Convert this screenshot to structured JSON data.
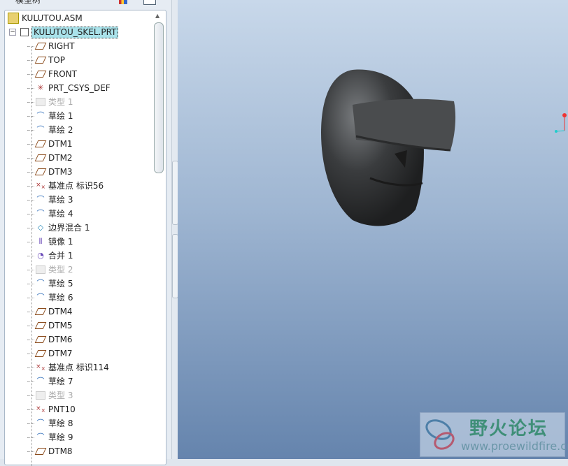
{
  "panel": {
    "title": "模型树"
  },
  "tree": {
    "root": "KULUTOU.ASM",
    "part": "KULUTOU_SKEL.PRT",
    "items": [
      {
        "label": "RIGHT",
        "icon": "datum-plane-icon"
      },
      {
        "label": "TOP",
        "icon": "datum-plane-icon"
      },
      {
        "label": "FRONT",
        "icon": "datum-plane-icon"
      },
      {
        "label": "PRT_CSYS_DEF",
        "icon": "csys-icon"
      },
      {
        "label": "类型 1",
        "icon": "suppressed-icon",
        "grey": true
      },
      {
        "label": "草绘 1",
        "icon": "sketch-icon"
      },
      {
        "label": "草绘 2",
        "icon": "sketch-icon"
      },
      {
        "label": "DTM1",
        "icon": "datum-plane-icon"
      },
      {
        "label": "DTM2",
        "icon": "datum-plane-icon"
      },
      {
        "label": "DTM3",
        "icon": "datum-plane-icon"
      },
      {
        "label": "基准点 标识56",
        "icon": "datum-point-icon"
      },
      {
        "label": "草绘 3",
        "icon": "sketch-icon"
      },
      {
        "label": "草绘 4",
        "icon": "sketch-icon"
      },
      {
        "label": "边界混合 1",
        "icon": "boundary-blend-icon"
      },
      {
        "label": "镜像 1",
        "icon": "mirror-icon"
      },
      {
        "label": "合并 1",
        "icon": "merge-icon"
      },
      {
        "label": "类型 2",
        "icon": "suppressed-icon",
        "grey": true
      },
      {
        "label": "草绘 5",
        "icon": "sketch-icon"
      },
      {
        "label": "草绘 6",
        "icon": "sketch-icon"
      },
      {
        "label": "DTM4",
        "icon": "datum-plane-icon"
      },
      {
        "label": "DTM5",
        "icon": "datum-plane-icon"
      },
      {
        "label": "DTM6",
        "icon": "datum-plane-icon"
      },
      {
        "label": "DTM7",
        "icon": "datum-plane-icon"
      },
      {
        "label": "基准点 标识114",
        "icon": "datum-point-icon"
      },
      {
        "label": "草绘 7",
        "icon": "sketch-icon"
      },
      {
        "label": "类型 3",
        "icon": "suppressed-icon",
        "grey": true
      },
      {
        "label": "PNT10",
        "icon": "datum-point-icon"
      },
      {
        "label": "草绘 8",
        "icon": "sketch-icon"
      },
      {
        "label": "草绘 9",
        "icon": "sketch-icon"
      },
      {
        "label": "DTM8",
        "icon": "datum-plane-icon"
      }
    ]
  },
  "watermark": {
    "name": "野火论坛",
    "url": "www.proewildfire.cn"
  }
}
